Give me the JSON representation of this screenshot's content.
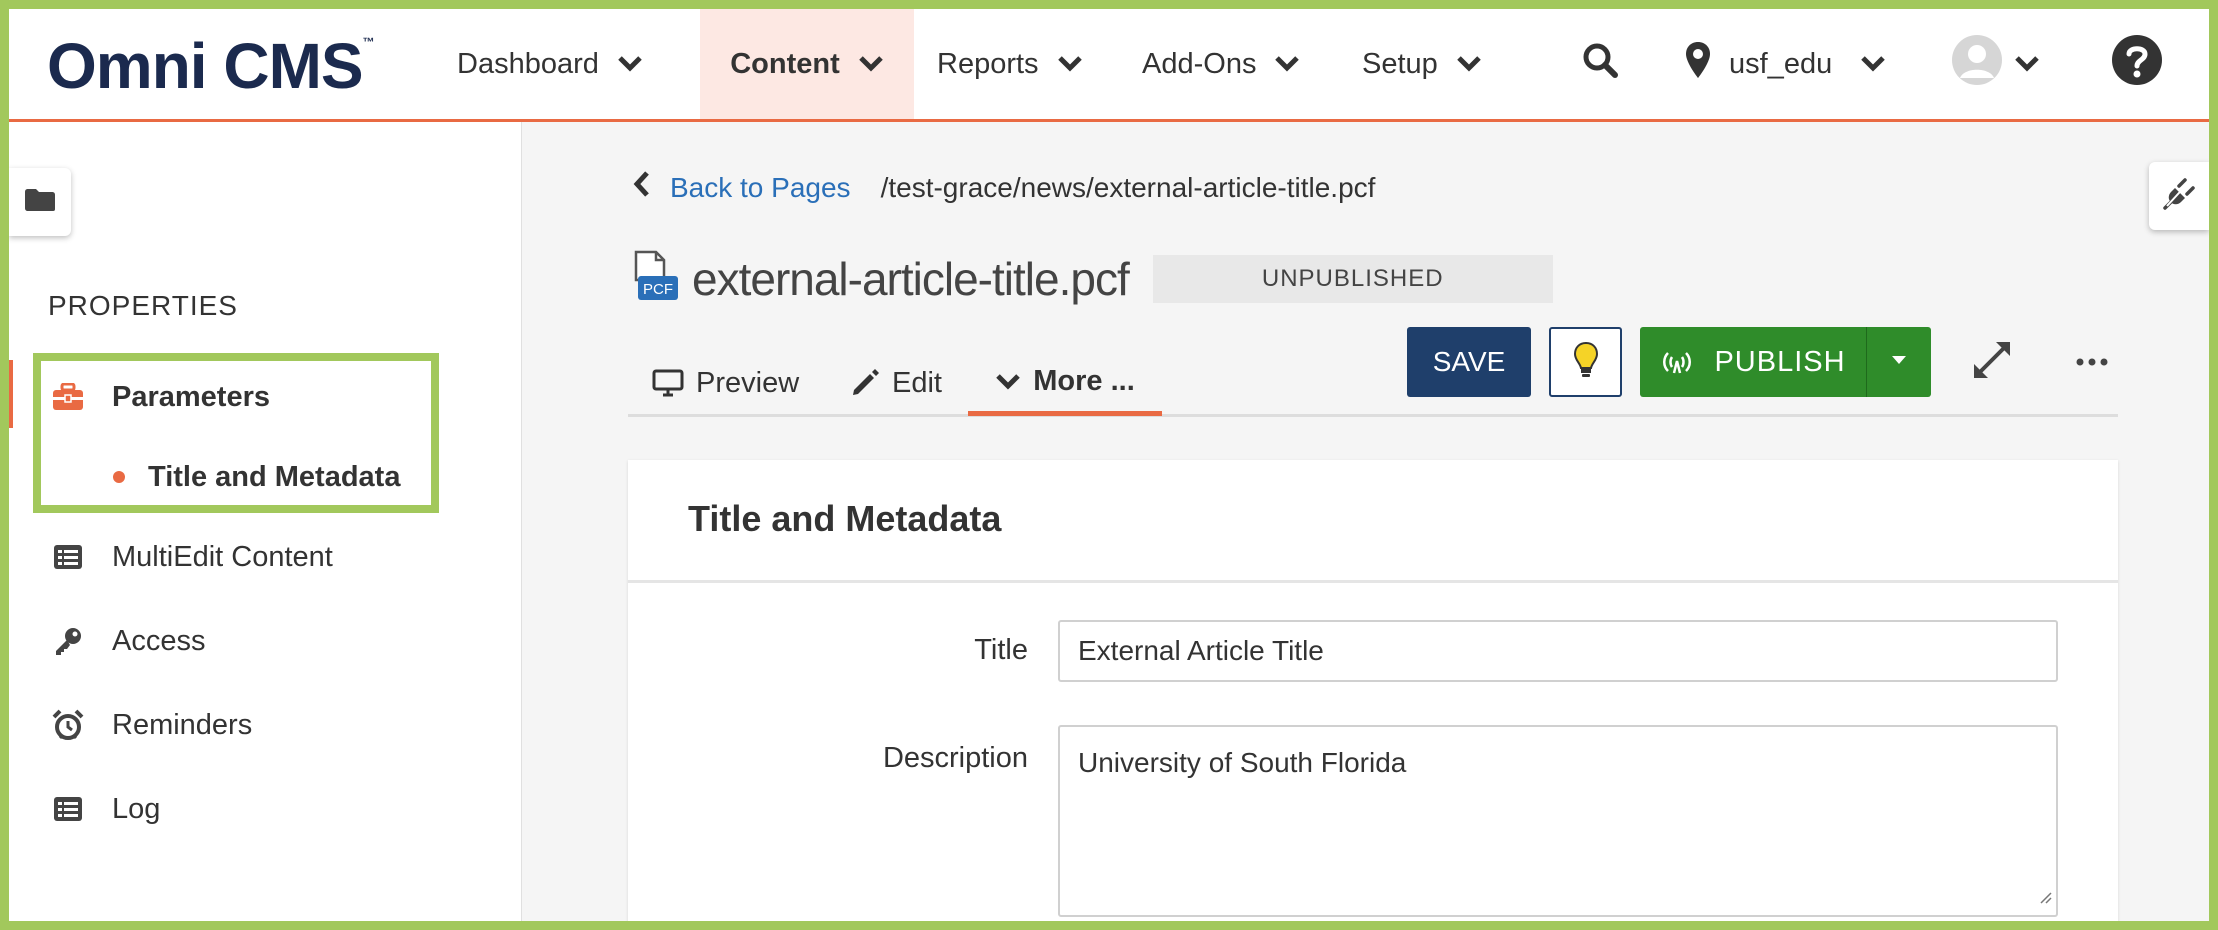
{
  "brand": {
    "logo_text": "Omni CMS",
    "trademark": "™"
  },
  "nav": {
    "items": [
      {
        "label": "Dashboard"
      },
      {
        "label": "Content"
      },
      {
        "label": "Reports"
      },
      {
        "label": "Add-Ons"
      },
      {
        "label": "Setup"
      }
    ],
    "active": "Content",
    "account": "usf_edu"
  },
  "sidebar": {
    "heading": "PROPERTIES",
    "items": [
      {
        "label": "Parameters",
        "icon": "toolbox-icon"
      },
      {
        "label": "Title and Metadata",
        "icon": "dot"
      },
      {
        "label": "MultiEdit Content",
        "icon": "list-icon"
      },
      {
        "label": "Access",
        "icon": "key-icon"
      },
      {
        "label": "Reminders",
        "icon": "alarm-clock-icon"
      },
      {
        "label": "Log",
        "icon": "list-icon"
      }
    ]
  },
  "breadcrumb": {
    "back_label": "Back to Pages",
    "path": "/test-grace/news/external-article-title.pcf"
  },
  "file": {
    "icon_badge": "PCF",
    "name": "external-article-title.pcf",
    "status": "UNPUBLISHED"
  },
  "tabs": [
    {
      "label": "Preview"
    },
    {
      "label": "Edit"
    },
    {
      "label": "More ..."
    }
  ],
  "toolbar": {
    "save_label": "SAVE",
    "publish_label": "PUBLISH"
  },
  "panel": {
    "title": "Title and Metadata",
    "fields": {
      "title_label": "Title",
      "title_value": "External Article Title",
      "description_label": "Description",
      "description_value": "University of South Florida"
    }
  },
  "colors": {
    "accent": "#e96a43",
    "brand_navy": "#1b2a4e",
    "save_blue": "#1f3f6b",
    "publish_green": "#2f8c2a",
    "highlight_green": "#a2c85c",
    "link_blue": "#2a6fb8"
  }
}
